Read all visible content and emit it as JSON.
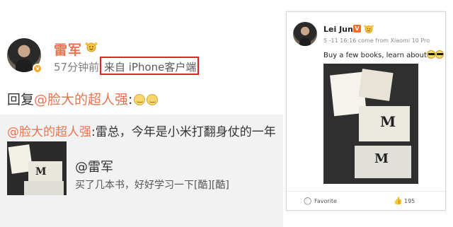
{
  "left_post": {
    "author": "雷军",
    "time": "57分钟前",
    "source": "来自 iPhone客户端",
    "reply_prefix": "回复",
    "reply_mention": "@脸大的超人强",
    "reply_colon": ":",
    "quote_mention": "@脸大的超人强",
    "quote_text": ":雷总，今年是小米打翻身仗的一年",
    "quoted_author": "@雷军",
    "quoted_text": "买了几本书，好好学习一下[酷][酷]",
    "highlight_color": "#e02424"
  },
  "right_post": {
    "author": "Lei Jun",
    "meta": "5 -11 16:16 come from Xiaomi 10 Pro",
    "text": "Buy a few books, learn about",
    "favorite_label": "Favorite",
    "like_count": "195"
  }
}
